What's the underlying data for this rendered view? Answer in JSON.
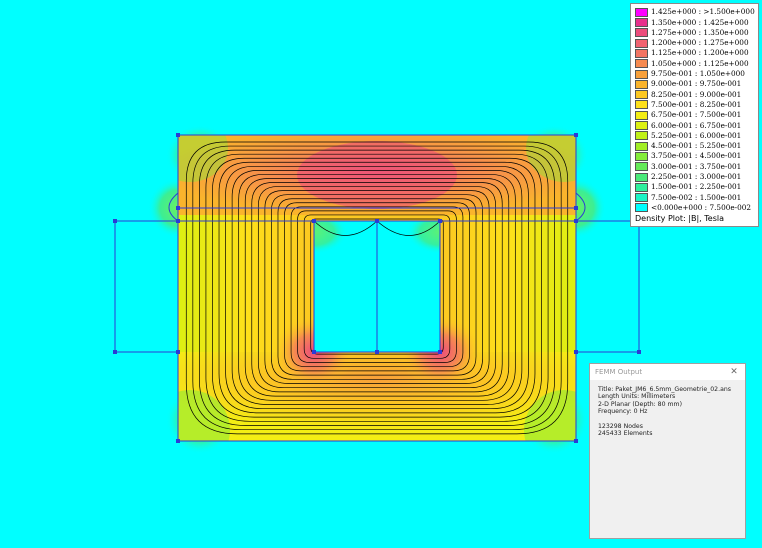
{
  "legend": {
    "items": [
      {
        "label": "1.425e+000 : >1.500e+000",
        "color": "#ff00ff"
      },
      {
        "label": "1.350e+000 : 1.425e+000",
        "color": "#e8308c"
      },
      {
        "label": "1.275e+000 : 1.350e+000",
        "color": "#ec4c7c"
      },
      {
        "label": "1.200e+000 : 1.275e+000",
        "color": "#f06270"
      },
      {
        "label": "1.125e+000 : 1.200e+000",
        "color": "#f27462"
      },
      {
        "label": "1.050e+000 : 1.125e+000",
        "color": "#f68a50"
      },
      {
        "label": "9.750e-001 : 1.050e+000",
        "color": "#f8a03a"
      },
      {
        "label": "9.000e-001 : 9.750e-001",
        "color": "#fab42c"
      },
      {
        "label": "8.250e-001 : 9.000e-001",
        "color": "#fcc822"
      },
      {
        "label": "7.500e-001 : 8.250e-001",
        "color": "#fee01a"
      },
      {
        "label": "6.750e-001 : 7.500e-001",
        "color": "#f4ee14"
      },
      {
        "label": "6.000e-001 : 6.750e-001",
        "color": "#dcf012"
      },
      {
        "label": "5.250e-001 : 6.000e-001",
        "color": "#c0f018"
      },
      {
        "label": "4.500e-001 : 5.250e-001",
        "color": "#a2ee26"
      },
      {
        "label": "3.750e-001 : 4.500e-001",
        "color": "#84ec3a"
      },
      {
        "label": "3.000e-001 : 3.750e-001",
        "color": "#64ea58"
      },
      {
        "label": "2.250e-001 : 3.000e-001",
        "color": "#4aea7a"
      },
      {
        "label": "1.500e-001 : 2.250e-001",
        "color": "#30f09e"
      },
      {
        "label": "7.500e-002 : 1.500e-001",
        "color": "#1cf4c6"
      },
      {
        "label": "<0.000e+000 : 7.500e-002",
        "color": "#00ffff"
      }
    ],
    "caption": "Density Plot: |B|, Tesla"
  },
  "femm_output": {
    "window_title": "FEMM Output",
    "close_glyph": "✕",
    "lines": [
      "Title: Paket_JM6_6.5mm_Geometrie_02.ans",
      "Length Units: Millimeters",
      "2-D Planar (Depth: 80 mm)",
      "Frequency: 0 Hz"
    ],
    "stats": [
      "123298 Nodes",
      "245433 Elements"
    ]
  },
  "colors": {
    "background": "#00ffff",
    "geometry_lines": "#2b3bd6",
    "flux_lines": "#000000"
  }
}
